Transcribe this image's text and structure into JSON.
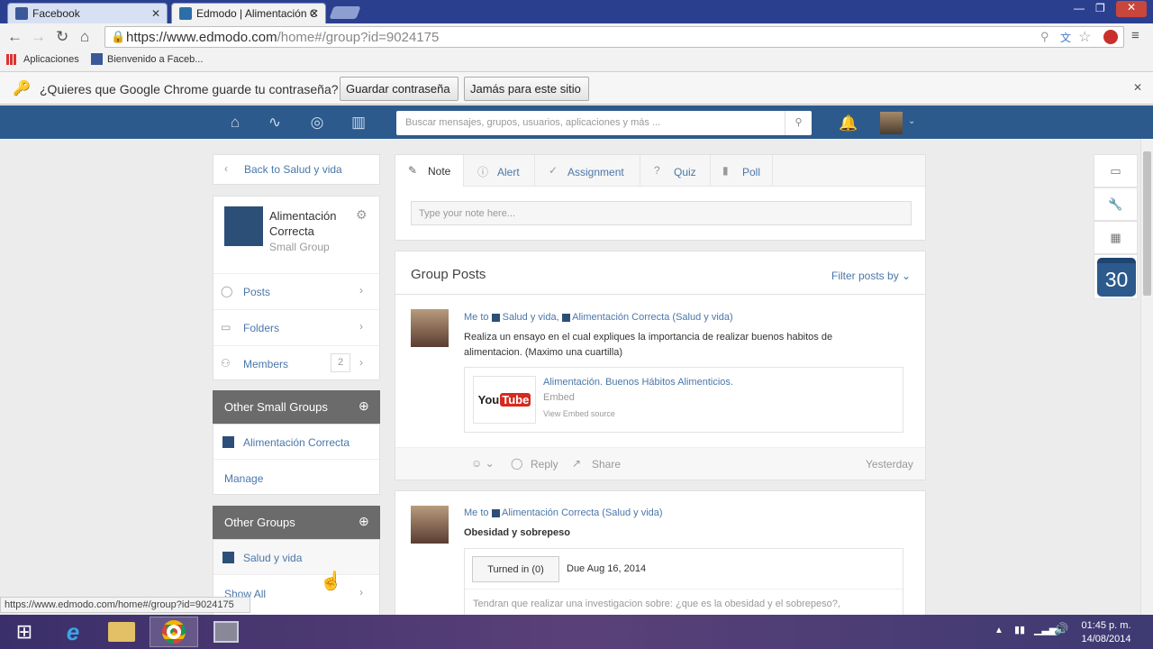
{
  "browser": {
    "tabs": [
      {
        "label": "Facebook"
      },
      {
        "label": "Edmodo | Alimentación C"
      }
    ],
    "url_host": "https://www.edmodo.com",
    "url_path": "/home#/group?id=9024175",
    "bookmarks": [
      {
        "label": "Aplicaciones"
      },
      {
        "label": "Bienvenido a Faceb..."
      }
    ],
    "password_prompt": {
      "text": "¿Quieres que Google Chrome guarde tu contraseña?",
      "save_label": "Guardar contraseña",
      "never_label": "Jamás para este sitio"
    },
    "status_url": "https://www.edmodo.com/home#/group?id=9024175"
  },
  "nav": {
    "search_placeholder": "Buscar mensajes, grupos, usuarios, aplicaciones y más ..."
  },
  "sidebar": {
    "back_label": "Back to Salud y vida",
    "group_name": "Alimentación Correcta",
    "group_type": "Small Group",
    "menu": [
      {
        "label": "Posts"
      },
      {
        "label": "Folders"
      },
      {
        "label": "Members",
        "count": "2"
      }
    ],
    "other_small": {
      "title": "Other Small Groups",
      "item": "Alimentación Correcta",
      "manage": "Manage"
    },
    "other_groups": {
      "title": "Other Groups",
      "item": "Salud y vida",
      "show_all": "Show All"
    }
  },
  "composer": {
    "tabs": [
      {
        "label": "Note"
      },
      {
        "label": "Alert"
      },
      {
        "label": "Assignment"
      },
      {
        "label": "Quiz"
      },
      {
        "label": "Poll"
      }
    ],
    "placeholder": "Type your note here..."
  },
  "posts": {
    "title": "Group Posts",
    "filter": "Filter posts by",
    "items": [
      {
        "me_to": "Me to",
        "group1": "Salud y vida,",
        "group2": "Alimentación Correcta (Salud y vida)",
        "text": "Realiza un ensayo en el cual expliques la importancia de realizar buenos habitos de alimentacion. (Maximo una cuartilla)",
        "embed_title": "Alimentación. Buenos Hábitos Alimenticios.",
        "embed_type": "Embed",
        "embed_source": "View Embed source",
        "reply": "Reply",
        "share": "Share",
        "time": "Yesterday"
      },
      {
        "me_to": "Me to",
        "group1": "Alimentación Correcta (Salud y vida)",
        "title": "Obesidad y sobrepeso",
        "turned_in": "Turned in (0)",
        "due": "Due Aug 16, 2014",
        "text": "Tendran que realizar una investigacion sobre: ¿que es la obesidad y el sobrepeso?,"
      }
    ]
  },
  "calendar": {
    "day": "30"
  },
  "taskbar": {
    "time": "01:45 p. m.",
    "date": "14/08/2014"
  }
}
